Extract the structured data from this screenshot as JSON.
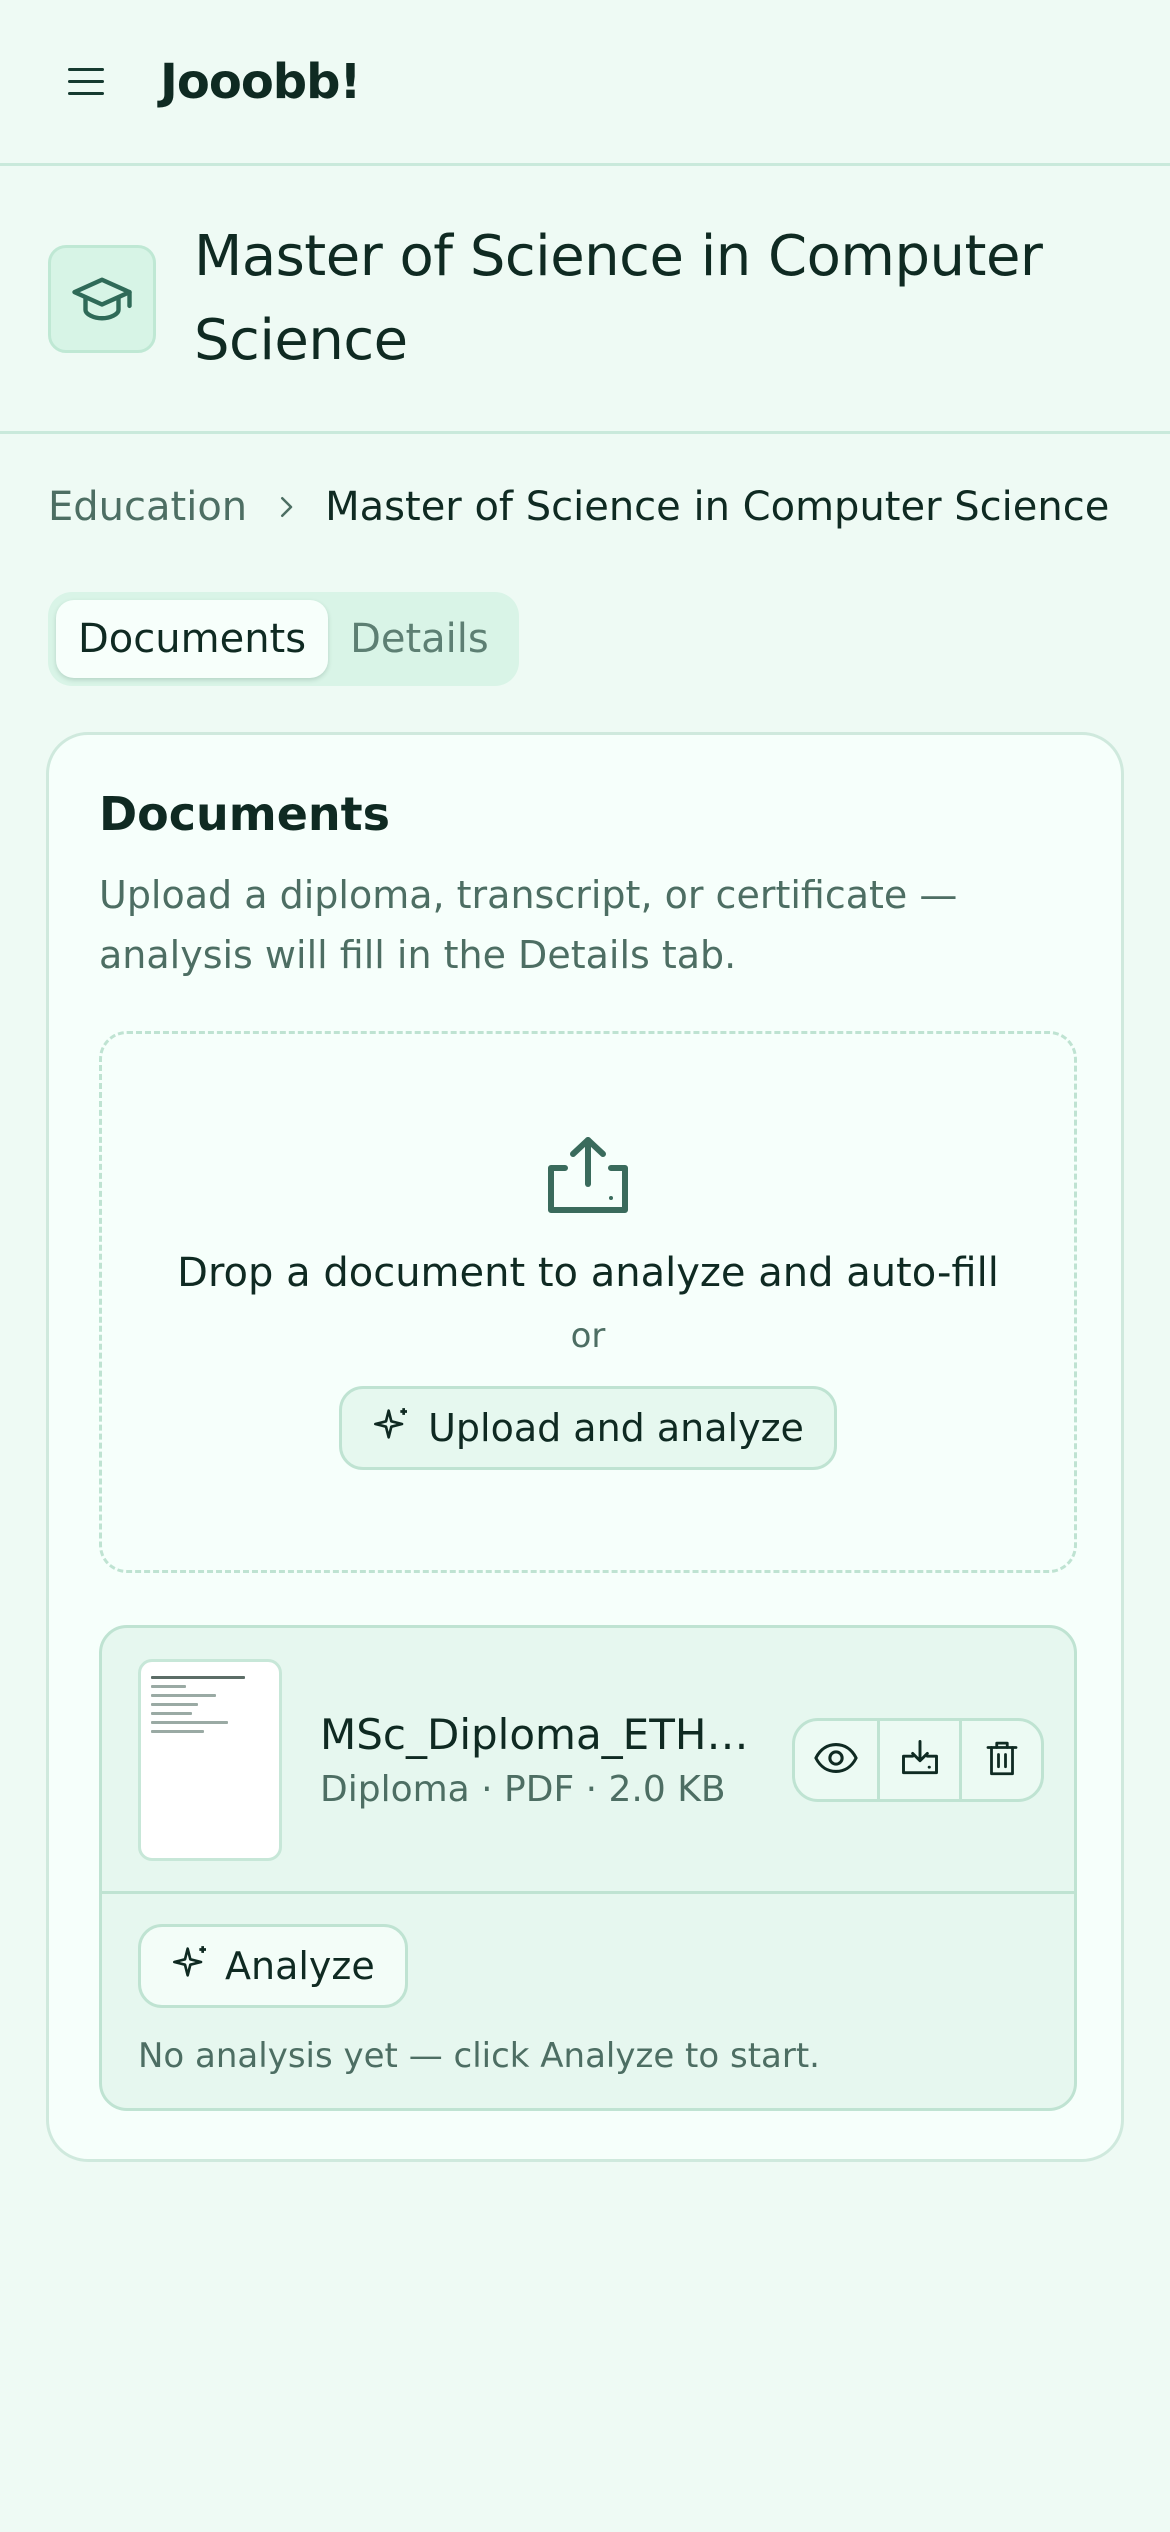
{
  "app": {
    "brand": "Jooobb!"
  },
  "page": {
    "title": "Master of Science in Computer Science"
  },
  "breadcrumb": {
    "parent": "Education",
    "current": "Master of Science in Computer Science"
  },
  "tabs": [
    {
      "label": "Documents",
      "active": true
    },
    {
      "label": "Details",
      "active": false
    }
  ],
  "documents_card": {
    "title": "Documents",
    "description": "Upload a diploma, transcript, or certificate — analysis will fill in the Details tab.",
    "dropzone": {
      "title": "Drop a document to analyze and auto-fill",
      "or": "or",
      "button_label": "Upload and analyze"
    },
    "document": {
      "name": "MSc_Diploma_ETH_Zurich.pdf",
      "type": "Diploma",
      "format": "PDF",
      "size": "2.0 KB",
      "meta": "Diploma · PDF · 2.0 KB",
      "thumbnail_title": "Master of Science in Computer Science",
      "analyze_label": "Analyze",
      "analysis_status": "No analysis yet — click Analyze to start."
    }
  },
  "icons": {
    "menu": "hamburger-icon",
    "title": "graduation-cap-icon",
    "breadcrumb_sep": "chevron-right-icon",
    "upload": "upload-tray-icon",
    "sparkle": "sparkle-icon",
    "view": "eye-icon",
    "download": "download-tray-icon",
    "delete": "trash-icon"
  },
  "colors": {
    "background": "#eefaf4",
    "accent": "#2f6a58",
    "border": "#bfe3d2",
    "text": "#0f2a22",
    "muted": "#4d6e63"
  }
}
